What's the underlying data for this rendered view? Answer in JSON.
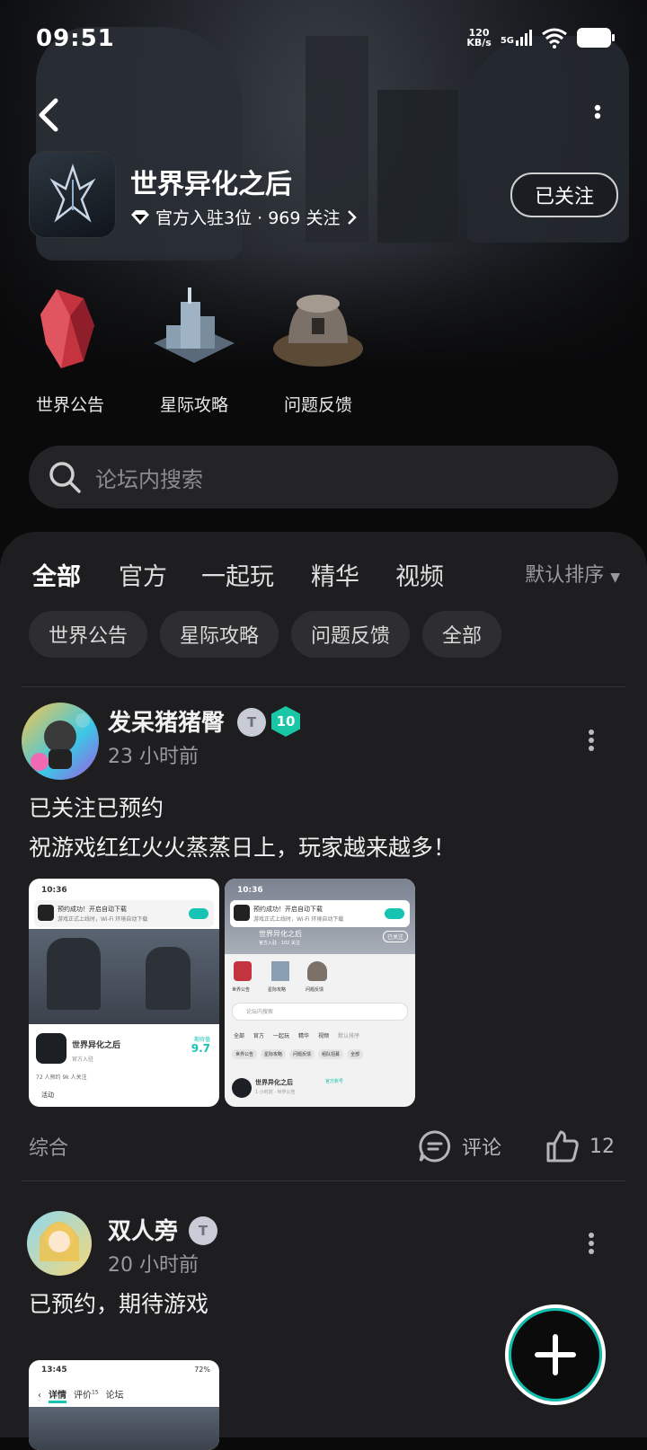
{
  "status_bar": {
    "time": "09:51",
    "net_speed_value": "120",
    "net_speed_unit": "KB/s",
    "network": "5G"
  },
  "game": {
    "title": "世界异化之后",
    "meta": "官方入驻3位 · 969 关注",
    "follow_label": "已关注"
  },
  "shortcuts": [
    {
      "label": "世界公告",
      "icon": "red-crystal-icon"
    },
    {
      "label": "星际攻略",
      "icon": "space-city-icon"
    },
    {
      "label": "问题反馈",
      "icon": "machine-dome-icon"
    }
  ],
  "search": {
    "placeholder": "论坛内搜索"
  },
  "tabs": [
    "全部",
    "官方",
    "一起玩",
    "精华",
    "视频"
  ],
  "sort_label": "默认排序",
  "chips": [
    "世界公告",
    "星际攻略",
    "问题反馈",
    "全部"
  ],
  "posts": [
    {
      "author": "发呆猪猪臀",
      "time": "23 小时前",
      "badge_level": "10",
      "lines": [
        "已关注已预约",
        "祝游戏红红火火蒸蒸日上，玩家越来越多！"
      ],
      "category": "综合",
      "comment_label": "评论",
      "like_count": "12",
      "thumb1": {
        "time": "10:36",
        "toast_title": "预约成功！开启自动下载",
        "toast_sub": "游戏正式上线时，Wi-Fi 环境自动下载",
        "game_name": "世界异化之后",
        "official": "官方入驻",
        "score_label": "期待值",
        "score": "9.7",
        "stats": "72 人预约   9k 人关注",
        "activity": "活动"
      },
      "thumb2": {
        "time": "10:36",
        "toast_title": "预约成功！开启自动下载",
        "toast_sub": "游戏正式上线时，Wi-Fi 环境自动下载",
        "game_name": "世界异化之后",
        "meta": "官方入驻 · 102 关注",
        "follow": "已关注",
        "shortcuts": [
          "世界公告",
          "星际攻略",
          "问题反馈"
        ],
        "search": "论坛内搜索",
        "tabs": [
          "全部",
          "官方",
          "一起玩",
          "精华",
          "视频",
          "默认排序"
        ],
        "chips": [
          "世界公告",
          "星际攻略",
          "问题反馈",
          "组队招募",
          "全部"
        ],
        "post_name": "世界异化之后",
        "post_tag": "官方账号",
        "post_time": "1 小时前 · 世界公告"
      }
    },
    {
      "author": "双人旁",
      "time": "20 小时前",
      "lines": [
        "已预约，期待游戏"
      ],
      "thumb1": {
        "time": "13:45",
        "battery": "72%",
        "tab_detail": "详情",
        "tab_review": "评价",
        "review_count": "15",
        "tab_forum": "论坛"
      }
    }
  ],
  "colors": {
    "accent": "#0fbfb0",
    "panel": "#1e1e20",
    "chip": "#2e2e31"
  }
}
